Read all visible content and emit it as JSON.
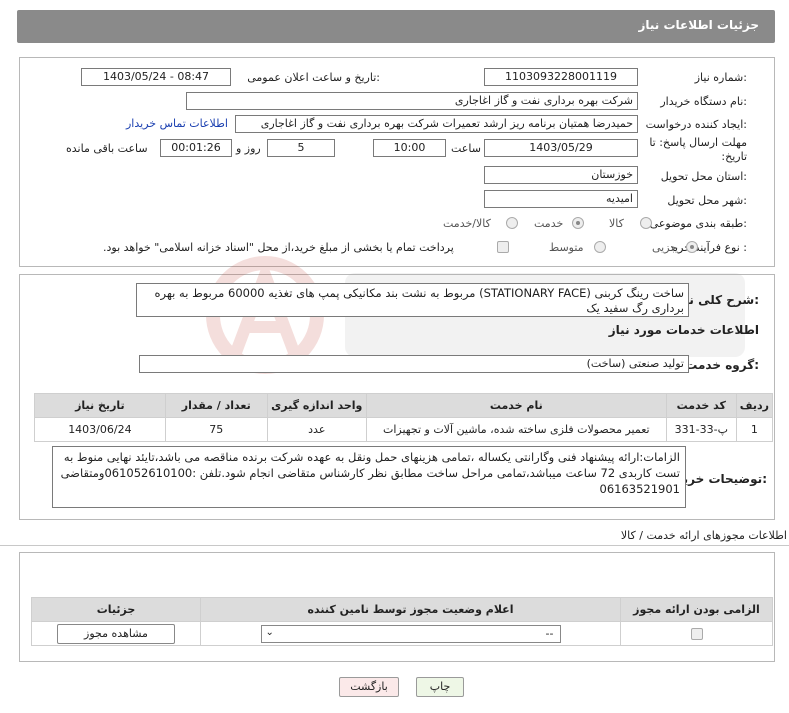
{
  "header": {
    "title": "جزئیات اطلاعات نیاز"
  },
  "need_number": {
    "label": "شماره نیاز:",
    "value": "1103093228001119"
  },
  "announce": {
    "label": "تاریخ و ساعت اعلان عمومی:",
    "value": "1403/05/24 - 08:47"
  },
  "buyer": {
    "label": "نام دستگاه خریدار:",
    "value": "شرکت بهره برداری نفت و گاز اغاجاری"
  },
  "creator": {
    "label": "ایجاد کننده درخواست:",
    "value": "حمیدرضا همتیان برنامه ریز ارشد تعمیرات شرکت بهره برداری نفت و گاز اغاجاری",
    "contact_link": "اطلاعات تماس خریدار"
  },
  "deadline": {
    "label": "مهلت ارسال پاسخ: تا تاریخ:",
    "date": "1403/05/29",
    "time_label": "ساعت",
    "time": "10:00",
    "days": "5",
    "days_label": "روز و",
    "remaining": "00:01:26",
    "remaining_label": "ساعت باقی مانده"
  },
  "province": {
    "label": "استان محل تحویل:",
    "value": "خوزستان"
  },
  "city": {
    "label": "شهر محل تحویل:",
    "value": "امیدیه"
  },
  "category": {
    "label": "طبقه بندی موضوعی:",
    "options": [
      "کالا",
      "خدمت",
      "کالا/خدمت"
    ],
    "selected": "خدمت"
  },
  "process": {
    "label": "نوع فرآیند خرید :",
    "options": [
      "جزیی",
      "متوسط"
    ],
    "selected": "جزیی",
    "treasury_note": "پرداخت تمام یا بخشی از مبلغ خرید،از محل \"اسناد خزانه اسلامی\" خواهد بود."
  },
  "description": {
    "label": "شرح کلی نیاز:",
    "value": "ساخت رینگ کربنی (STATIONARY FACE) مربوط به نشت بند مکانیکی پمپ های تغذیه 60000 مربوط به بهره برداری رگ سفید یک"
  },
  "services": {
    "title": "اطلاعات خدمات مورد نیاز",
    "group_label": "گروه خدمت:",
    "group_value": "تولید صنعتی (ساخت)",
    "columns": [
      "ردیف",
      "کد خدمت",
      "نام خدمت",
      "واحد اندازه گیری",
      "تعداد / مقدار",
      "تاریخ نیاز"
    ],
    "rows": [
      [
        "1",
        "پ-33-331",
        "تعمیر محصولات فلزی ساخته شده، ماشین آلات و تجهیزات",
        "عدد",
        "75",
        "1403/06/24"
      ]
    ]
  },
  "buyer_notes": {
    "label": "توضیحات خریدار:",
    "value": "الزامات:ارائه پیشنهاد فنی وگارانتی یکساله ،تمامی هزینهای حمل ونقل به عهده شرکت برنده مناقصه می باشد،تایئد نهایی منوط به تست کاربدی 72 ساعت میباشد،تمامی مراحل ساخت مطابق نظر کارشناس متقاضی انجام شود.تلفن :061052610100ومتقاضی 06163521901"
  },
  "permits": {
    "title": "اطلاعات مجوزهای ارائه خدمت / کالا",
    "columns": [
      "الزامی بودن ارائه مجوز",
      "اعلام وضعیت مجوز توسط نامین کننده",
      "جزئیات"
    ],
    "select_value": "--",
    "view_button": "مشاهده مجوز"
  },
  "actions": {
    "print": "چاپ",
    "back": "بازگشت"
  },
  "colors": {
    "header": "#8a8a8a",
    "link": "#1a3fb0",
    "table_head": "#dcdcdc",
    "print_bg": "#eef7e6",
    "back_bg": "#fbe9e9"
  }
}
